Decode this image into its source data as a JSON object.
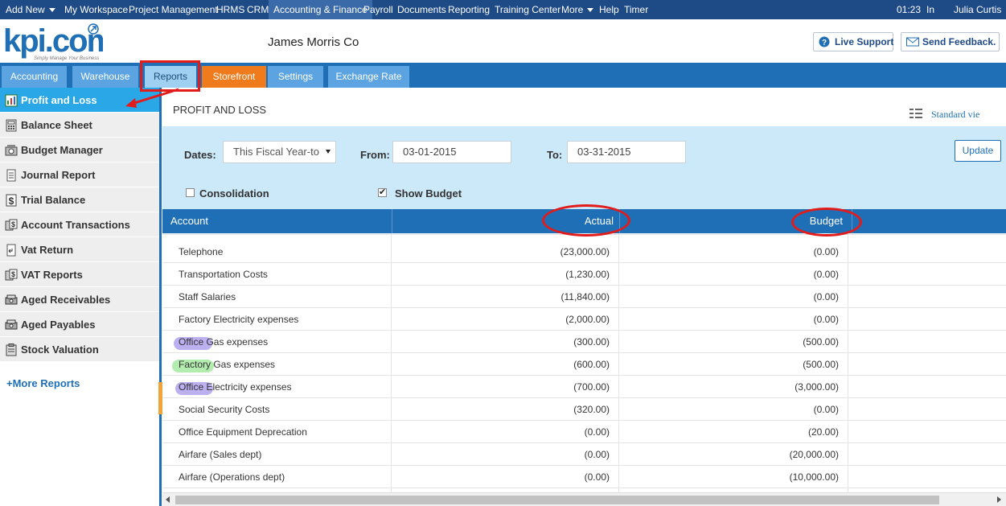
{
  "topnav": {
    "items": [
      "Add New",
      "My Workspace",
      "Project Management",
      "HRMS",
      "CRM",
      "Accounting & Finance",
      "Payroll",
      "Documents",
      "Reporting",
      "Training Center",
      "More",
      "Help",
      "Timer"
    ],
    "time": "01:23",
    "status": "In",
    "user": "Julia Curtis"
  },
  "header": {
    "logo_text": "kpi.com",
    "logo_tagline": "Simply Manage Your Business",
    "company": "James Morris Co",
    "live_support": "Live Support",
    "send_feedback": "Send Feedback."
  },
  "tabs": [
    "Accounting",
    "Warehouse",
    "Reports",
    "Storefront",
    "Settings",
    "Exchange Rate"
  ],
  "sidebar": {
    "items": [
      "Profit and Loss",
      "Balance Sheet",
      "Budget Manager",
      "Journal Report",
      "Trial Balance",
      "Account Transactions",
      "Vat Return",
      "VAT Reports",
      "Aged Receivables",
      "Aged Payables",
      "Stock Valuation"
    ],
    "more": "+More Reports"
  },
  "main": {
    "title": "PROFIT AND LOSS",
    "standard_view": "Standard vie"
  },
  "filters": {
    "dates_label": "Dates:",
    "dates_value": "This Fiscal Year-to",
    "from_label": "From:",
    "from_value": "03-01-2015",
    "to_label": "To:",
    "to_value": "03-31-2015",
    "update": "Update",
    "consolidation": "Consolidation",
    "show_budget": "Show Budget"
  },
  "table": {
    "headers": {
      "account": "Account",
      "actual": "Actual",
      "budget": "Budget"
    },
    "rows": [
      {
        "account": "Telephone",
        "actual": "(23,000.00)",
        "budget": "(0.00)"
      },
      {
        "account": "Transportation Costs",
        "actual": "(1,230.00)",
        "budget": "(0.00)"
      },
      {
        "account": "Staff Salaries",
        "actual": "(11,840.00)",
        "budget": "(0.00)"
      },
      {
        "account": "Factory Electricity expenses",
        "actual": "(2,000.00)",
        "budget": "(0.00)"
      },
      {
        "account": "Office Gas expenses",
        "actual": "(300.00)",
        "budget": "(500.00)"
      },
      {
        "account": "Factory Gas expenses",
        "actual": "(600.00)",
        "budget": "(500.00)"
      },
      {
        "account": "Office Electricity expenses",
        "actual": "(700.00)",
        "budget": "(3,000.00)"
      },
      {
        "account": "Social Security Costs",
        "actual": "(320.00)",
        "budget": "(0.00)"
      },
      {
        "account": "Office Equipment Deprecation",
        "actual": "(0.00)",
        "budget": "(20.00)"
      },
      {
        "account": "Airfare (Sales dept)",
        "actual": "(0.00)",
        "budget": "(20,000.00)"
      },
      {
        "account": "Airfare (Operations dept)",
        "actual": "(0.00)",
        "budget": "(10,000.00)"
      }
    ]
  },
  "colors": {
    "nav_dark": "#1e4a86",
    "tab_bar": "#1f6fb6",
    "sidebar_active": "#29a7e6",
    "filter_bg": "#cbe9f9",
    "annotation_red": "#e21b1b"
  }
}
